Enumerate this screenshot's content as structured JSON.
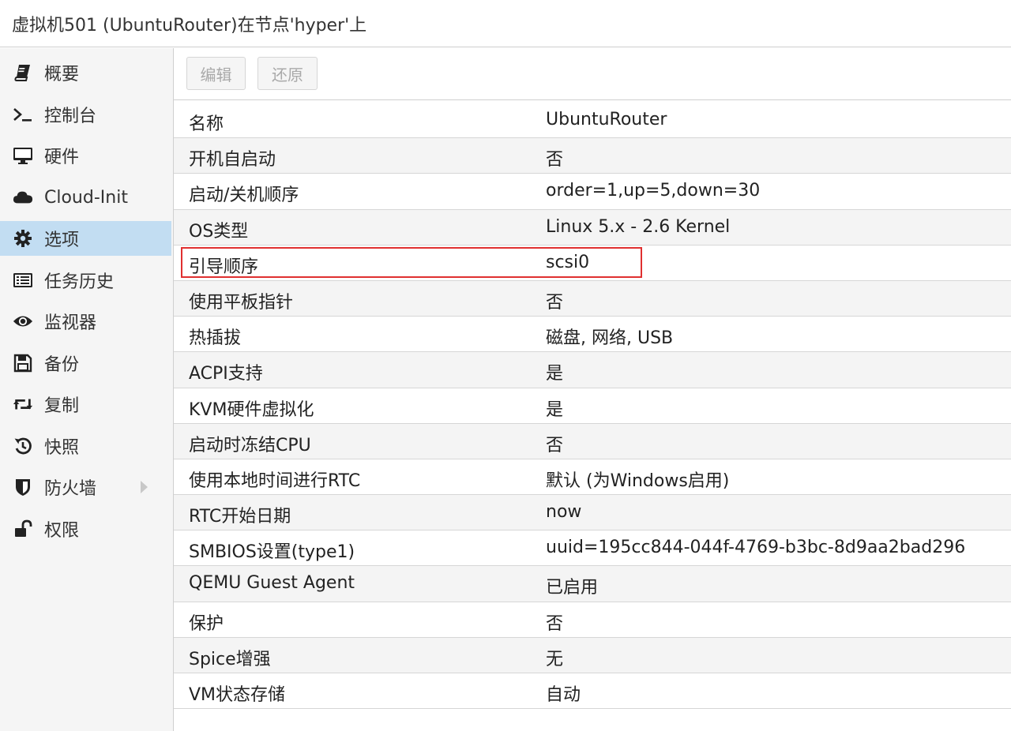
{
  "window": {
    "title": "虚拟机501 (UbuntuRouter)在节点'hyper'上"
  },
  "sidebar": {
    "items": [
      {
        "label": "概要",
        "icon": "book-icon"
      },
      {
        "label": "控制台",
        "icon": "terminal-icon"
      },
      {
        "label": "硬件",
        "icon": "monitor-icon"
      },
      {
        "label": "Cloud-Init",
        "icon": "cloud-icon"
      },
      {
        "label": "选项",
        "icon": "gear-icon",
        "selected": true
      },
      {
        "label": "任务历史",
        "icon": "list-icon"
      },
      {
        "label": "监视器",
        "icon": "eye-icon"
      },
      {
        "label": "备份",
        "icon": "floppy-disk-icon"
      },
      {
        "label": "复制",
        "icon": "retweet-icon"
      },
      {
        "label": "快照",
        "icon": "history-icon"
      },
      {
        "label": "防火墙",
        "icon": "shield-icon",
        "has_submenu": true
      },
      {
        "label": "权限",
        "icon": "unlock-icon"
      }
    ]
  },
  "toolbar": {
    "edit_label": "编辑",
    "revert_label": "还原"
  },
  "options": {
    "rows": [
      {
        "key": "名称",
        "value": "UbuntuRouter"
      },
      {
        "key": "开机自启动",
        "value": "否"
      },
      {
        "key": "启动/关机顺序",
        "value": "order=1,up=5,down=30"
      },
      {
        "key": "OS类型",
        "value": "Linux 5.x - 2.6 Kernel"
      },
      {
        "key": "引导顺序",
        "value": "scsi0",
        "highlighted": true
      },
      {
        "key": "使用平板指针",
        "value": "否"
      },
      {
        "key": "热插拔",
        "value": "磁盘, 网络, USB"
      },
      {
        "key": "ACPI支持",
        "value": "是"
      },
      {
        "key": "KVM硬件虚拟化",
        "value": "是"
      },
      {
        "key": "启动时冻结CPU",
        "value": "否"
      },
      {
        "key": "使用本地时间进行RTC",
        "value": "默认 (为Windows启用)"
      },
      {
        "key": "RTC开始日期",
        "value": "now"
      },
      {
        "key": "SMBIOS设置(type1)",
        "value": "uuid=195cc844-044f-4769-b3bc-8d9aa2bad296"
      },
      {
        "key": "QEMU Guest Agent",
        "value": "已启用"
      },
      {
        "key": "保护",
        "value": "否"
      },
      {
        "key": "Spice增强",
        "value": "无"
      },
      {
        "key": "VM状态存储",
        "value": "自动"
      }
    ]
  },
  "colors": {
    "selected_bg": "#c2ddf2",
    "highlight_border": "#e03030",
    "sidebar_bg": "#f5f5f5"
  }
}
